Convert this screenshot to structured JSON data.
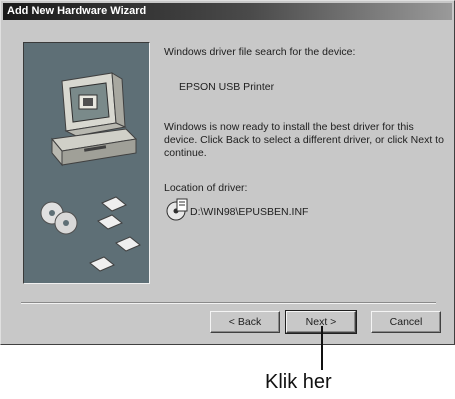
{
  "window": {
    "title": "Add New Hardware Wizard"
  },
  "content": {
    "intro": "Windows driver file search for the device:",
    "device_name": "EPSON USB Printer",
    "instructions": "Windows is now ready to install the best driver for this device. Click Back to select a different driver, or click Next to continue.",
    "location_label": "Location of driver:",
    "driver_path": "D:\\WIN98\\EPUSBEN.INF"
  },
  "buttons": {
    "back": "< Back",
    "next": "Next >",
    "cancel": "Cancel"
  },
  "callout": {
    "label": "Klik her"
  }
}
